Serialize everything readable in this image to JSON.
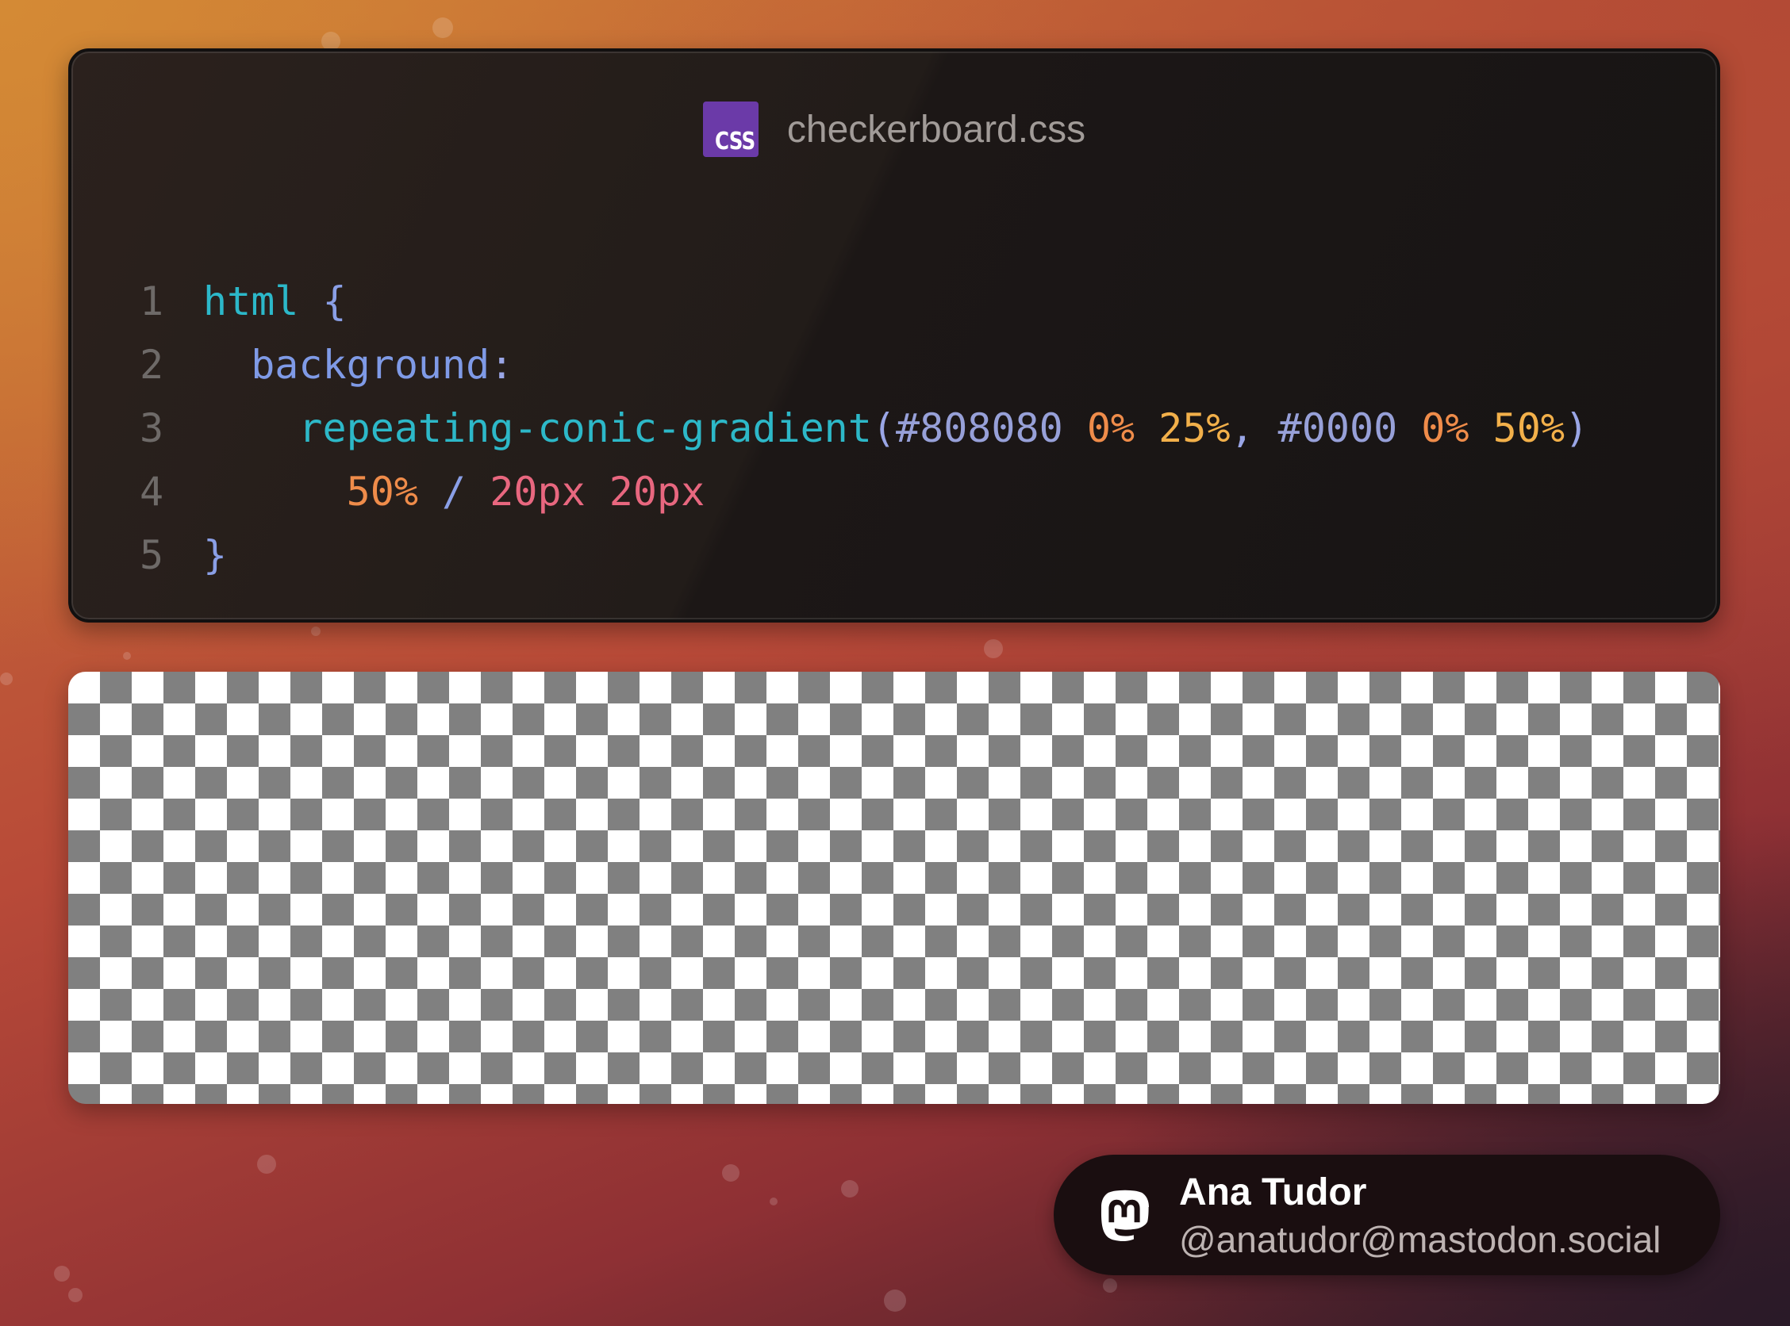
{
  "editor": {
    "file_badge": "CSS",
    "filename": "checkerboard.css",
    "lines": [
      {
        "number": "1",
        "tokens": [
          {
            "t": "html",
            "c": "tok-sel"
          },
          {
            "t": " ",
            "c": ""
          },
          {
            "t": "{",
            "c": "tok-brace"
          }
        ]
      },
      {
        "number": "2",
        "tokens": [
          {
            "t": "  background",
            "c": "tok-prop"
          },
          {
            "t": ":",
            "c": "tok-punct"
          }
        ]
      },
      {
        "number": "3",
        "tokens": [
          {
            "t": "    repeating-conic-gradient",
            "c": "tok-fn"
          },
          {
            "t": "(",
            "c": "tok-punct"
          },
          {
            "t": "#808080",
            "c": "tok-color"
          },
          {
            "t": " ",
            "c": ""
          },
          {
            "t": "0%",
            "c": "tok-pct"
          },
          {
            "t": " ",
            "c": ""
          },
          {
            "t": "25%",
            "c": "tok-pct2"
          },
          {
            "t": ",",
            "c": "tok-punct"
          },
          {
            "t": " ",
            "c": ""
          },
          {
            "t": "#0000",
            "c": "tok-color"
          },
          {
            "t": " ",
            "c": ""
          },
          {
            "t": "0%",
            "c": "tok-pct"
          },
          {
            "t": " ",
            "c": ""
          },
          {
            "t": "50%",
            "c": "tok-pct2"
          },
          {
            "t": ")",
            "c": "tok-punct"
          }
        ]
      },
      {
        "number": "4",
        "tokens": [
          {
            "t": "      ",
            "c": ""
          },
          {
            "t": "50%",
            "c": "tok-pct"
          },
          {
            "t": " ",
            "c": ""
          },
          {
            "t": "/",
            "c": "tok-slash"
          },
          {
            "t": " ",
            "c": ""
          },
          {
            "t": "20px",
            "c": "tok-px"
          },
          {
            "t": " ",
            "c": ""
          },
          {
            "t": "20px",
            "c": "tok-px"
          }
        ]
      },
      {
        "number": "5",
        "tokens": [
          {
            "t": "}",
            "c": "tok-brace"
          }
        ]
      }
    ]
  },
  "preview": {
    "colors": [
      "#808080",
      "#ffffff"
    ]
  },
  "author": {
    "icon": "mastodon-icon",
    "name": "Ana Tudor",
    "handle": "@anatudor@mastodon.social"
  }
}
